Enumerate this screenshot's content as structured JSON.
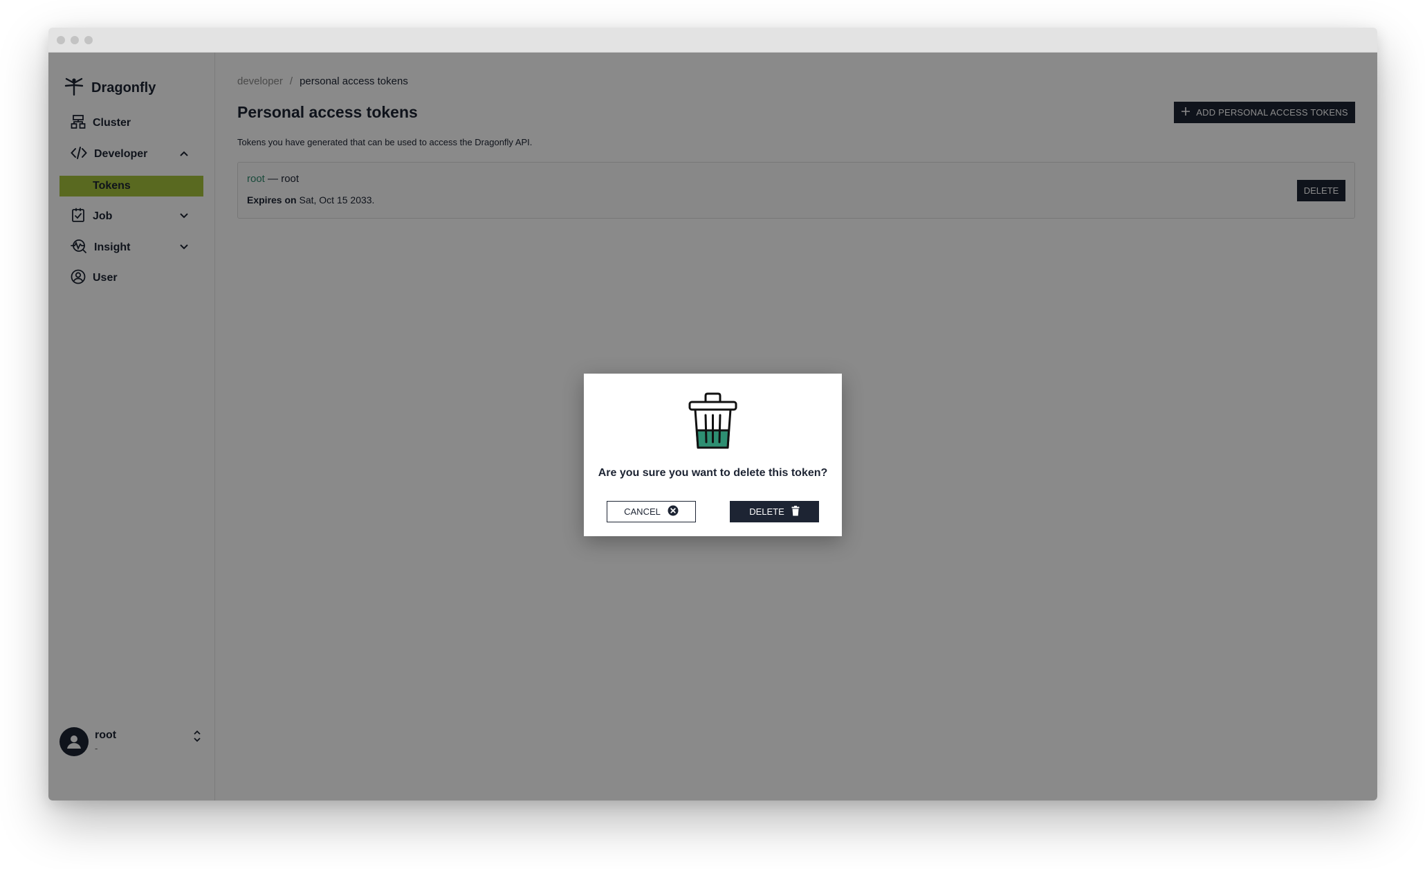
{
  "app": {
    "brand": "Dragonfly"
  },
  "sidebar": {
    "items": [
      {
        "label": "Cluster",
        "icon": "cluster-icon"
      },
      {
        "label": "Developer",
        "icon": "code-icon",
        "expanded": true
      },
      {
        "label": "Tokens",
        "active": true
      },
      {
        "label": "Job",
        "icon": "job-icon",
        "expanded": false
      },
      {
        "label": "Insight",
        "icon": "insight-icon",
        "expanded": false
      },
      {
        "label": "User",
        "icon": "user-circle-icon"
      }
    ],
    "active_color": "#a4c23b"
  },
  "user": {
    "name": "root",
    "subtext": "-"
  },
  "breadcrumb": {
    "parent": "developer",
    "separator": "/",
    "current": "personal access tokens"
  },
  "page": {
    "title": "Personal access tokens",
    "subtitle": "Tokens you have generated that can be used to access the Dragonfly API.",
    "add_button": "ADD PERSONAL ACCESS TOKENS"
  },
  "tokens": [
    {
      "name": "root",
      "separator": "—",
      "user": "root",
      "expires_label": "Expires on",
      "expires_value": "Sat, Oct 15 2033.",
      "delete_label": "DELETE"
    }
  ],
  "modal": {
    "icon": "trash-can-icon",
    "message": "Are you sure you want to delete this token?",
    "cancel_label": "CANCEL",
    "delete_label": "DELETE"
  },
  "colors": {
    "primary": "#1d2433",
    "accent": "#2f8a6e"
  }
}
